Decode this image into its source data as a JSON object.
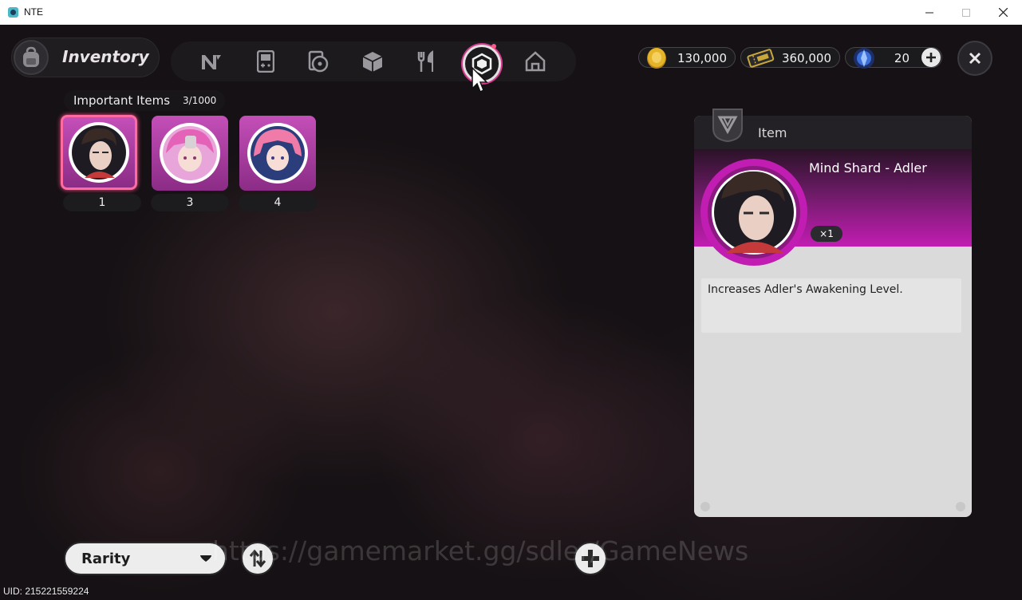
{
  "window": {
    "title": "NTE"
  },
  "header": {
    "title": "Inventory",
    "tabs": [
      {
        "icon": "n-logo-icon",
        "active": false
      },
      {
        "icon": "handheld-console-icon",
        "active": false
      },
      {
        "icon": "disc-case-icon",
        "active": false
      },
      {
        "icon": "box-icon",
        "active": false
      },
      {
        "icon": "fork-knife-icon",
        "active": false
      },
      {
        "icon": "important-items-icon",
        "active": true
      },
      {
        "icon": "home-icon",
        "active": false
      }
    ]
  },
  "currencies": [
    {
      "name": "gold-coin",
      "value": "130,000",
      "color": "#e5b429"
    },
    {
      "name": "ticket",
      "value": "360,000",
      "color": "#c9a83a"
    },
    {
      "name": "crystal",
      "value": "20",
      "color": "#3a6fd9"
    }
  ],
  "section": {
    "name": "Important Items",
    "count": "3/1000"
  },
  "items": [
    {
      "number": "1",
      "selected": true,
      "color": "#c44fb8"
    },
    {
      "number": "3",
      "selected": false,
      "color": "#c44fb8"
    },
    {
      "number": "4",
      "selected": false,
      "color": "#c44fb8"
    }
  ],
  "detail": {
    "header": "Item",
    "name": "Mind Shard - Adler",
    "quantity": "×1",
    "description": "Increases Adler's Awakening Level.",
    "accent": "#c21db2"
  },
  "footer": {
    "sort_label": "Rarity",
    "watermark": "https://gamemarket.gg/sdler/GameNews",
    "uid": "UID: 215221559224"
  }
}
